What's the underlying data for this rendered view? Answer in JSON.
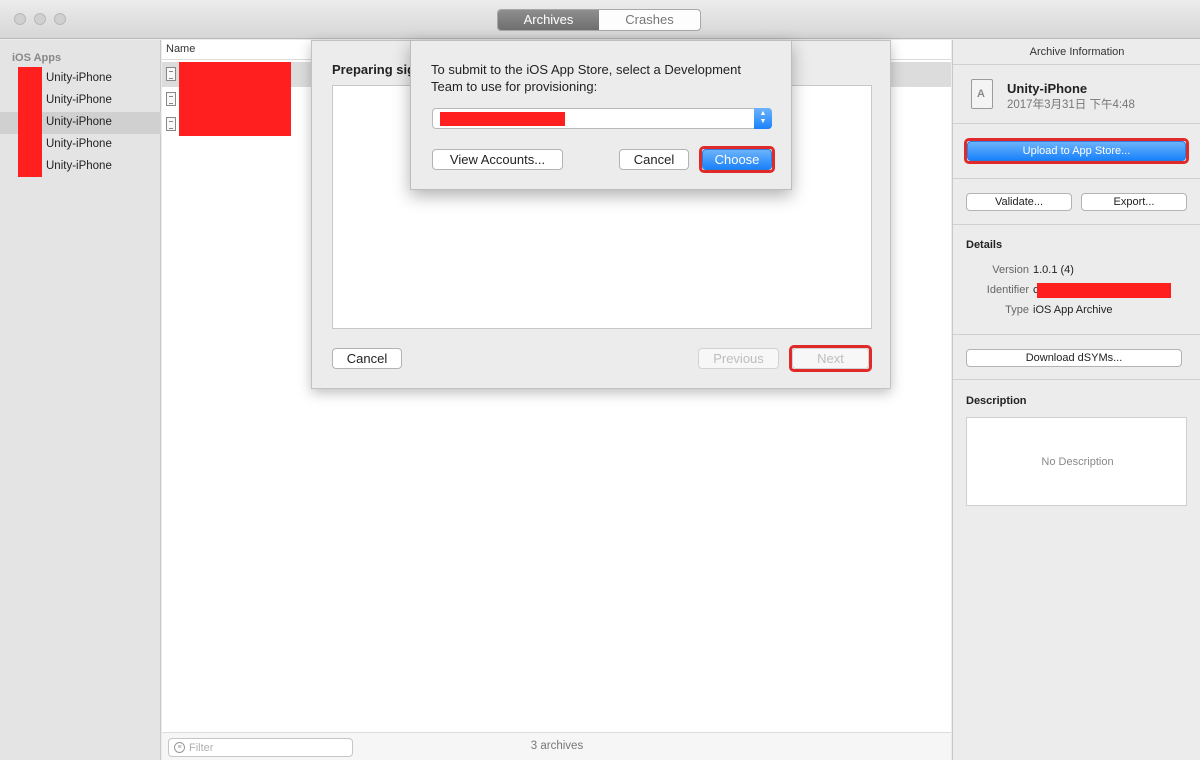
{
  "window": {
    "tabs": [
      {
        "label": "Archives",
        "active": true
      },
      {
        "label": "Crashes",
        "active": false
      }
    ]
  },
  "sidebar": {
    "header": "iOS Apps",
    "items": [
      {
        "label": "Unity-iPhone",
        "selected": false
      },
      {
        "label": "Unity-iPhone",
        "selected": false
      },
      {
        "label": "Unity-iPhone",
        "selected": true
      },
      {
        "label": "Unity-iPhone",
        "selected": false
      },
      {
        "label": "Unity-iPhone",
        "selected": false
      }
    ]
  },
  "archive_list": {
    "column_header": "Name",
    "rows": 3,
    "filter_placeholder": "Filter",
    "count_label": "3 archives"
  },
  "signing_sheet": {
    "title": "Preparing signing...",
    "cancel_label": "Cancel",
    "previous_label": "Previous",
    "next_label": "Next"
  },
  "team_dialog": {
    "message": "To submit to the iOS App Store, select a Development Team to use for provisioning:",
    "view_accounts_label": "View Accounts...",
    "cancel_label": "Cancel",
    "choose_label": "Choose"
  },
  "inspector": {
    "header": "Archive Information",
    "app_name": "Unity-iPhone",
    "date": "2017年3月31日 下午4:48",
    "upload_label": "Upload to App Store...",
    "validate_label": "Validate...",
    "export_label": "Export...",
    "details_title": "Details",
    "details": {
      "version_key": "Version",
      "version_val": "1.0.1 (4)",
      "identifier_key": "Identifier",
      "identifier_val": "c",
      "type_key": "Type",
      "type_val": "iOS App Archive"
    },
    "download_dsyms_label": "Download dSYMs...",
    "description_title": "Description",
    "description_placeholder": "No Description"
  },
  "colors": {
    "accent_blue": "#1a82fb",
    "highlight_red": "#e02a2a",
    "redaction_red": "#ff1f1f"
  }
}
